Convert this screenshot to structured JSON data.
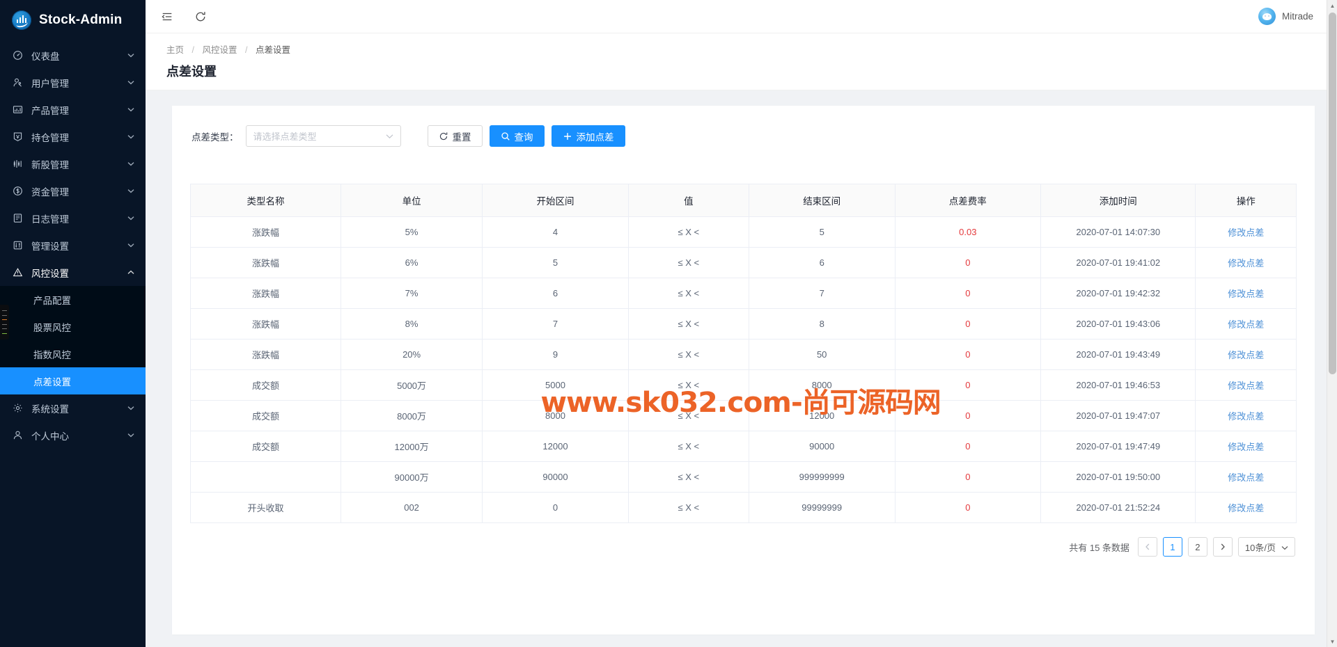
{
  "app": {
    "brand": "Stock-Admin",
    "logo_icon": "stock-chart-logo-icon"
  },
  "sidebar": {
    "items": [
      {
        "label": "仪表盘",
        "icon": "dashboard-icon",
        "chevron": "chevron-down-icon"
      },
      {
        "label": "用户管理",
        "icon": "user-manage-icon",
        "chevron": "chevron-down-icon"
      },
      {
        "label": "产品管理",
        "icon": "bar-chart-icon",
        "chevron": "chevron-down-icon"
      },
      {
        "label": "持仓管理",
        "icon": "position-icon",
        "chevron": "chevron-down-icon"
      },
      {
        "label": "新股管理",
        "icon": "candlestick-icon",
        "chevron": "chevron-down-icon"
      },
      {
        "label": "资金管理",
        "icon": "dollar-circle-icon",
        "chevron": "chevron-down-icon"
      },
      {
        "label": "日志管理",
        "icon": "log-icon",
        "chevron": "chevron-down-icon"
      },
      {
        "label": "管理设置",
        "icon": "sliders-icon",
        "chevron": "chevron-down-icon"
      },
      {
        "label": "风控设置",
        "icon": "warning-triangle-icon",
        "chevron": "chevron-up-icon"
      }
    ],
    "risk_submenu": [
      {
        "label": "产品配置",
        "selected": false
      },
      {
        "label": "股票风控",
        "selected": false
      },
      {
        "label": "指数风控",
        "selected": false
      },
      {
        "label": "点差设置",
        "selected": true
      }
    ],
    "bottom_items": [
      {
        "label": "系统设置",
        "icon": "gear-icon",
        "chevron": "chevron-down-icon"
      },
      {
        "label": "个人中心",
        "icon": "person-icon",
        "chevron": "chevron-down-icon"
      }
    ]
  },
  "topbar": {
    "collapse_icon": "menu-fold-icon",
    "refresh_icon": "refresh-icon",
    "user_name": "Mitrade",
    "avatar_icon": "user-avatar-icon"
  },
  "page": {
    "breadcrumb": [
      "主页",
      "风控设置",
      "点差设置"
    ],
    "breadcrumb_sep": "/",
    "title": "点差设置"
  },
  "filter": {
    "label": "点差类型：",
    "select_placeholder": "请选择点差类型",
    "select_value": "",
    "select_arrow_icon": "chevron-down-icon",
    "reset_label": "重置",
    "reset_icon": "reset-icon",
    "search_label": "查询",
    "search_icon": "search-icon",
    "add_label": "添加点差",
    "add_icon": "plus-icon"
  },
  "table": {
    "columns": [
      "类型名称",
      "单位",
      "开始区间",
      "值",
      "结束区间",
      "点差费率",
      "添加时间",
      "操作"
    ],
    "action_label": "修改点差",
    "rows": [
      {
        "type": "涨跌幅",
        "unit": "5%",
        "start": "4",
        "value": "≤ X <",
        "end": "5",
        "rate": "0.03",
        "time": "2020-07-01 14:07:30"
      },
      {
        "type": "涨跌幅",
        "unit": "6%",
        "start": "5",
        "value": "≤ X <",
        "end": "6",
        "rate": "0",
        "time": "2020-07-01 19:41:02"
      },
      {
        "type": "涨跌幅",
        "unit": "7%",
        "start": "6",
        "value": "≤ X <",
        "end": "7",
        "rate": "0",
        "time": "2020-07-01 19:42:32"
      },
      {
        "type": "涨跌幅",
        "unit": "8%",
        "start": "7",
        "value": "≤ X <",
        "end": "8",
        "rate": "0",
        "time": "2020-07-01 19:43:06"
      },
      {
        "type": "涨跌幅",
        "unit": "20%",
        "start": "9",
        "value": "≤ X <",
        "end": "50",
        "rate": "0",
        "time": "2020-07-01 19:43:49"
      },
      {
        "type": "成交额",
        "unit": "5000万",
        "start": "5000",
        "value": "≤ X <",
        "end": "8000",
        "rate": "0",
        "time": "2020-07-01 19:46:53"
      },
      {
        "type": "成交额",
        "unit": "8000万",
        "start": "8000",
        "value": "≤ X <",
        "end": "12000",
        "rate": "0",
        "time": "2020-07-01 19:47:07"
      },
      {
        "type": "成交额",
        "unit": "12000万",
        "start": "12000",
        "value": "≤ X <",
        "end": "90000",
        "rate": "0",
        "time": "2020-07-01 19:47:49"
      },
      {
        "type": "",
        "unit": "90000万",
        "start": "90000",
        "value": "≤ X <",
        "end": "999999999",
        "rate": "0",
        "time": "2020-07-01 19:50:00"
      },
      {
        "type": "开头收取",
        "unit": "002",
        "start": "0",
        "value": "≤ X <",
        "end": "99999999",
        "rate": "0",
        "time": "2020-07-01 21:52:24"
      }
    ]
  },
  "pagination": {
    "total_text": "共有 15 条数据",
    "prev_icon": "chevron-left-icon",
    "next_icon": "chevron-right-icon",
    "pages": [
      "1",
      "2"
    ],
    "current_page": "1",
    "page_size_label": "10条/页",
    "page_size_arrow_icon": "chevron-down-icon"
  },
  "watermark": {
    "text": "www.sk032.com-尚可源码网",
    "color": "#ec6327"
  },
  "colors": {
    "sidebar_bg": "#081527",
    "submenu_bg": "#000c17",
    "accent": "#1890ff",
    "danger": "#e4393c",
    "link": "#4b8fd6",
    "page_bg": "#f0f2f5"
  }
}
